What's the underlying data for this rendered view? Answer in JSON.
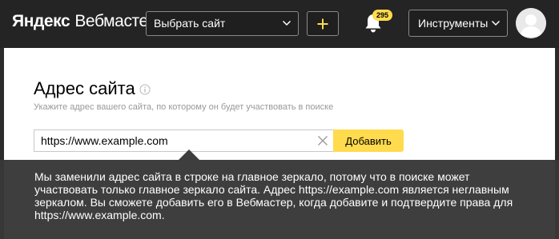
{
  "header": {
    "logo_brand": "Яндекс",
    "logo_product": "Вебмастер",
    "site_select_label": "Выбрать сайт",
    "add_icon": "plus-icon",
    "notifications_icon": "bell-icon",
    "notifications_count": "295",
    "tools_label": "Инструменты",
    "avatar_icon": "user-avatar"
  },
  "main": {
    "title": "Адрес сайта",
    "title_info_icon": "info-icon",
    "subtitle": "Укажите адрес вашего сайта, по которому он будет участвовать в поиске",
    "url_value": "https://www.example.com",
    "url_placeholder": "",
    "clear_icon": "close-icon",
    "add_button_label": "Добавить"
  },
  "tooltip": {
    "text": "Мы заменили адрес сайта в строке на главное зеркало, потому что в поиске может участвовать только главное зеркало сайта. Адрес https://example.com является неглавным зеркалом. Вы сможете добавить его в Вебмастер, когда добавите и подтвердите права для https://www.example.com."
  },
  "colors": {
    "accent": "#ffdb4d",
    "header_bg": "#242424",
    "tooltip_bg": "#383838"
  }
}
